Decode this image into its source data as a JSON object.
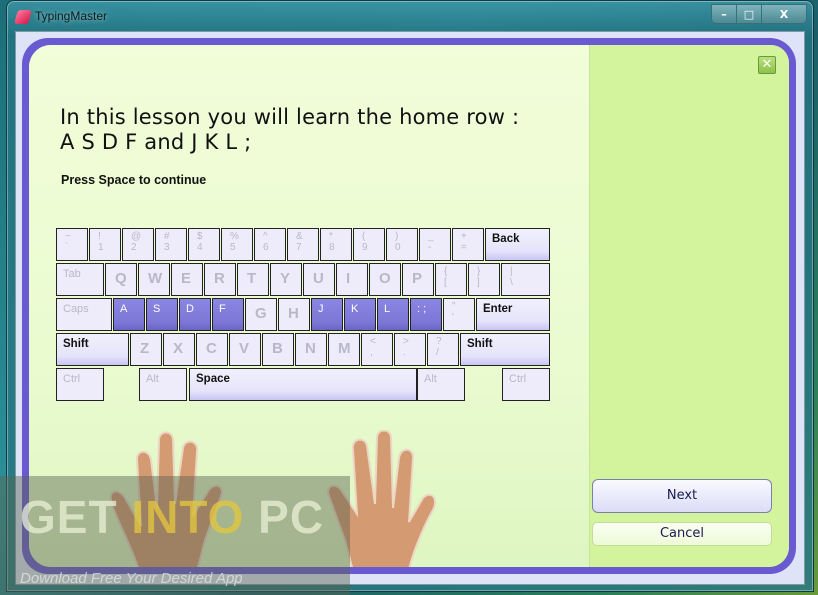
{
  "window": {
    "title": "TypingMaster",
    "app_icon": "typingmaster-logo-icon",
    "caption_buttons": {
      "minimize": "–",
      "maximize": "□",
      "close": "X"
    }
  },
  "lesson": {
    "title_line1": "In this lesson you will learn the home row :",
    "title_line2": "A S D F and J K L ;",
    "instruction": "Press Space to continue"
  },
  "panel_close": "✕",
  "keyboard": {
    "rows": [
      [
        {
          "label": "~\n`",
          "type": "sym"
        },
        {
          "label": "!\n1",
          "type": "sym"
        },
        {
          "label": "@\n2",
          "type": "sym"
        },
        {
          "label": "#\n3",
          "type": "sym"
        },
        {
          "label": "$\n4",
          "type": "sym"
        },
        {
          "label": "%\n5",
          "type": "sym"
        },
        {
          "label": "^\n6",
          "type": "sym"
        },
        {
          "label": "&\n7",
          "type": "sym"
        },
        {
          "label": "*\n8",
          "type": "sym"
        },
        {
          "label": "(\n9",
          "type": "sym"
        },
        {
          "label": ")\n0",
          "type": "sym"
        },
        {
          "label": "_\n-",
          "type": "sym"
        },
        {
          "label": "+\n=",
          "type": "sym"
        },
        {
          "label": "Back",
          "type": "active"
        }
      ],
      [
        {
          "label": "Tab",
          "type": "mod"
        },
        {
          "label": "Q",
          "type": "letter"
        },
        {
          "label": "W",
          "type": "letter"
        },
        {
          "label": "E",
          "type": "letter"
        },
        {
          "label": "R",
          "type": "letter"
        },
        {
          "label": "T",
          "type": "letter"
        },
        {
          "label": "Y",
          "type": "letter"
        },
        {
          "label": "U",
          "type": "letter"
        },
        {
          "label": "I",
          "type": "letter"
        },
        {
          "label": "O",
          "type": "letter"
        },
        {
          "label": "P",
          "type": "letter"
        },
        {
          "label": "{\n[",
          "type": "sym"
        },
        {
          "label": "}\n]",
          "type": "sym"
        },
        {
          "label": "|\n\\",
          "type": "sym"
        }
      ],
      [
        {
          "label": "Caps",
          "type": "mod"
        },
        {
          "label": "A",
          "type": "home"
        },
        {
          "label": "S",
          "type": "home"
        },
        {
          "label": "D",
          "type": "home"
        },
        {
          "label": "F",
          "type": "home"
        },
        {
          "label": "G",
          "type": "letter"
        },
        {
          "label": "H",
          "type": "letter"
        },
        {
          "label": "J",
          "type": "home"
        },
        {
          "label": "K",
          "type": "home"
        },
        {
          "label": "L",
          "type": "home"
        },
        {
          "label": ":\n;",
          "type": "home"
        },
        {
          "label": "\"\n'",
          "type": "sym"
        },
        {
          "label": "Enter",
          "type": "active"
        }
      ],
      [
        {
          "label": "Shift",
          "type": "active"
        },
        {
          "label": "Z",
          "type": "letter"
        },
        {
          "label": "X",
          "type": "letter"
        },
        {
          "label": "C",
          "type": "letter"
        },
        {
          "label": "V",
          "type": "letter"
        },
        {
          "label": "B",
          "type": "letter"
        },
        {
          "label": "N",
          "type": "letter"
        },
        {
          "label": "M",
          "type": "letter"
        },
        {
          "label": "<\n,",
          "type": "sym"
        },
        {
          "label": ">\n.",
          "type": "sym"
        },
        {
          "label": "?\n/",
          "type": "sym"
        },
        {
          "label": "Shift",
          "type": "active"
        }
      ],
      [
        {
          "label": "Ctrl",
          "type": "mod"
        },
        {
          "label": "Alt",
          "type": "mod"
        },
        {
          "label": "Space",
          "type": "active"
        },
        {
          "label": "Alt",
          "type": "mod"
        },
        {
          "label": "Ctrl",
          "type": "mod"
        }
      ]
    ]
  },
  "buttons": {
    "next": "Next",
    "cancel": "Cancel"
  },
  "watermark": {
    "get": "GET ",
    "into": "INTO",
    "pc": " PC",
    "tagline": "Download Free Your Desired App"
  }
}
